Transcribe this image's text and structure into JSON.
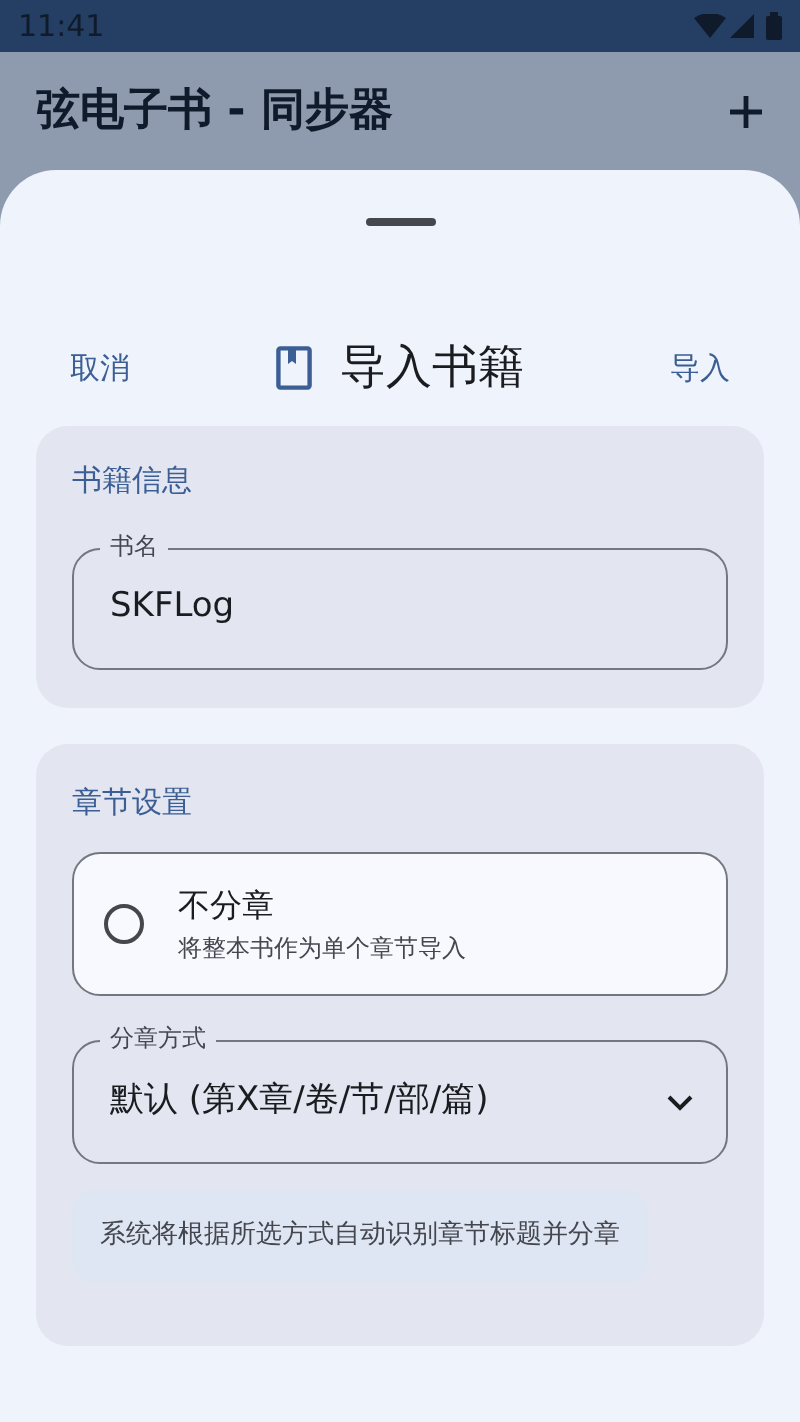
{
  "status_bar": {
    "time": "11:41"
  },
  "app_bar": {
    "title": "弦电子书 - 同步器"
  },
  "sheet": {
    "cancel": "取消",
    "title": "导入书籍",
    "confirm": "导入"
  },
  "book_info": {
    "heading": "书籍信息",
    "name_field": {
      "label": "书名",
      "value": "SKFLog"
    }
  },
  "chapter_settings": {
    "heading": "章节设置",
    "no_split": {
      "title": "不分章",
      "description": "将整本书作为单个章节导入",
      "selected": false
    },
    "split_method": {
      "label": "分章方式",
      "value": "默认 (第X章/卷/节/部/篇)"
    },
    "hint": "系统将根据所选方式自动识别章节标题并分章"
  }
}
